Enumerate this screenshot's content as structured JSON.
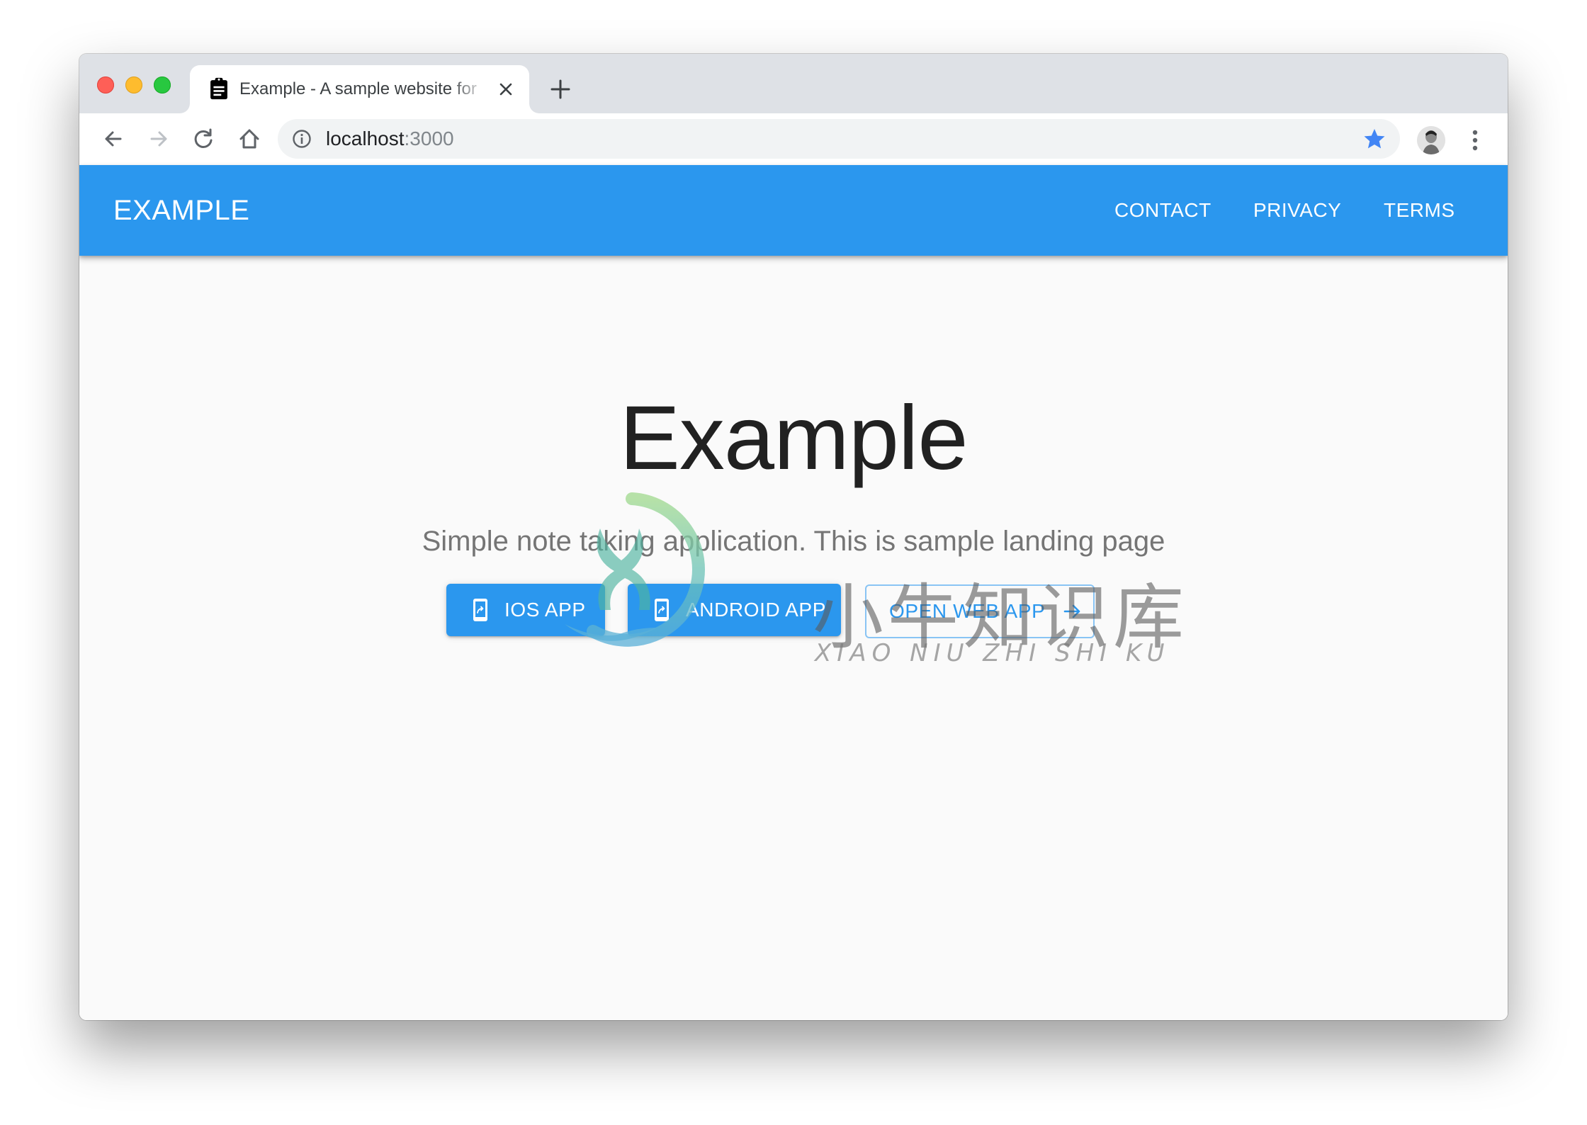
{
  "browser": {
    "tab": {
      "title": "Example - A sample website for",
      "icon": "clipboard-icon"
    },
    "address": {
      "host": "localhost",
      "port": ":3000"
    },
    "icons": {
      "back": "arrow-left",
      "forward": "arrow-right",
      "reload": "reload",
      "home": "home",
      "info": "info-circle",
      "bookmark": "star",
      "menu": "vertical-dots",
      "new_tab": "plus",
      "close_tab": "x"
    },
    "accent_color": "#4285f4"
  },
  "app": {
    "brand": "EXAMPLE",
    "nav": [
      {
        "label": "CONTACT"
      },
      {
        "label": "PRIVACY"
      },
      {
        "label": "TERMS"
      }
    ],
    "primary_color": "#2b97ee"
  },
  "hero": {
    "title": "Example",
    "subtitle": "Simple note taking application. This is sample landing page",
    "buttons": [
      {
        "label": "IOS APP",
        "icon": "mobile-share-icon",
        "variant": "contained"
      },
      {
        "label": "ANDROID APP",
        "icon": "mobile-share-icon",
        "variant": "contained"
      },
      {
        "label": "OPEN WEB APP",
        "icon": "arrow-right-icon",
        "variant": "outlined"
      }
    ]
  },
  "watermark": {
    "chinese": "小牛知识库",
    "latin": "XIAO NIU ZHI SHI KU"
  }
}
